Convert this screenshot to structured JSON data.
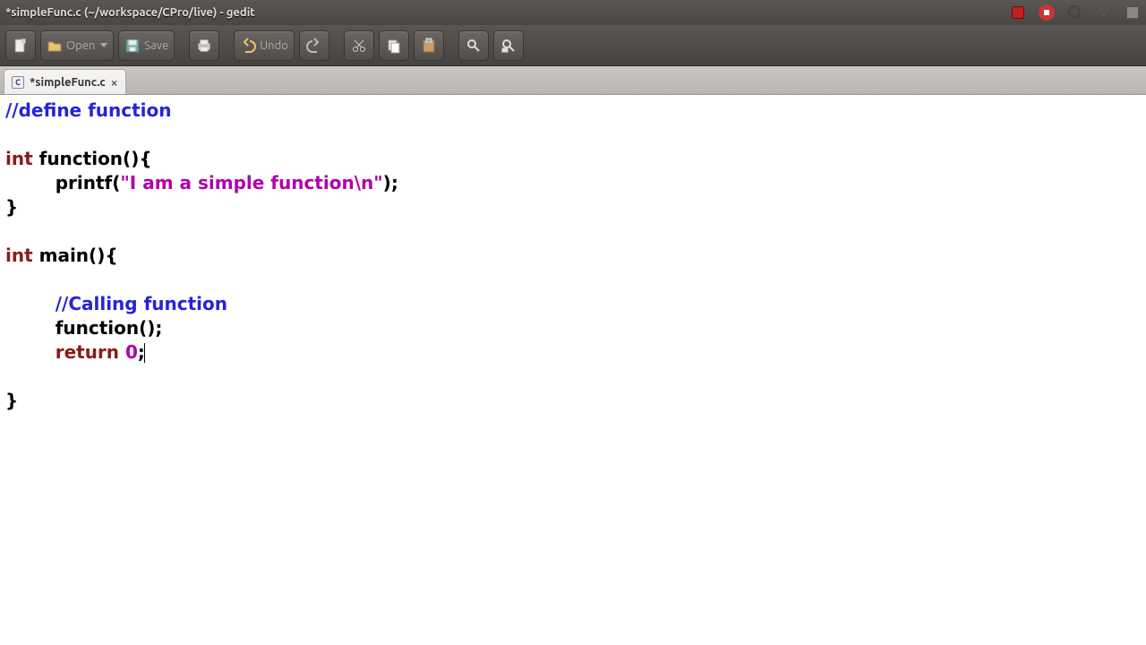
{
  "window": {
    "title": "*simpleFunc.c (~/workspace/CPro/live) - gedit"
  },
  "toolbar": {
    "open_label": "Open",
    "save_label": "Save",
    "undo_label": "Undo"
  },
  "tab": {
    "lang_badge": "C",
    "filename": "*simpleFunc.c",
    "close": "×"
  },
  "code": {
    "l1_comment": "//define function",
    "l3_type": "int",
    "l3_rest": " function(){",
    "l4_indent": "        ",
    "l4_call": "printf(",
    "l4_string": "\"I am a simple function",
    "l4_escape": "\\n",
    "l4_string_end": "\"",
    "l4_after": ");",
    "l5": "}",
    "l7_type": "int",
    "l7_rest": " main(){",
    "l9_indent": "        ",
    "l9_comment": "//Calling function",
    "l10_indent": "        ",
    "l10": "function();",
    "l11_indent": "        ",
    "l11_kw": "return",
    "l11_sp": " ",
    "l11_num": "0",
    "l11_semi": ";",
    "l13": "}"
  }
}
